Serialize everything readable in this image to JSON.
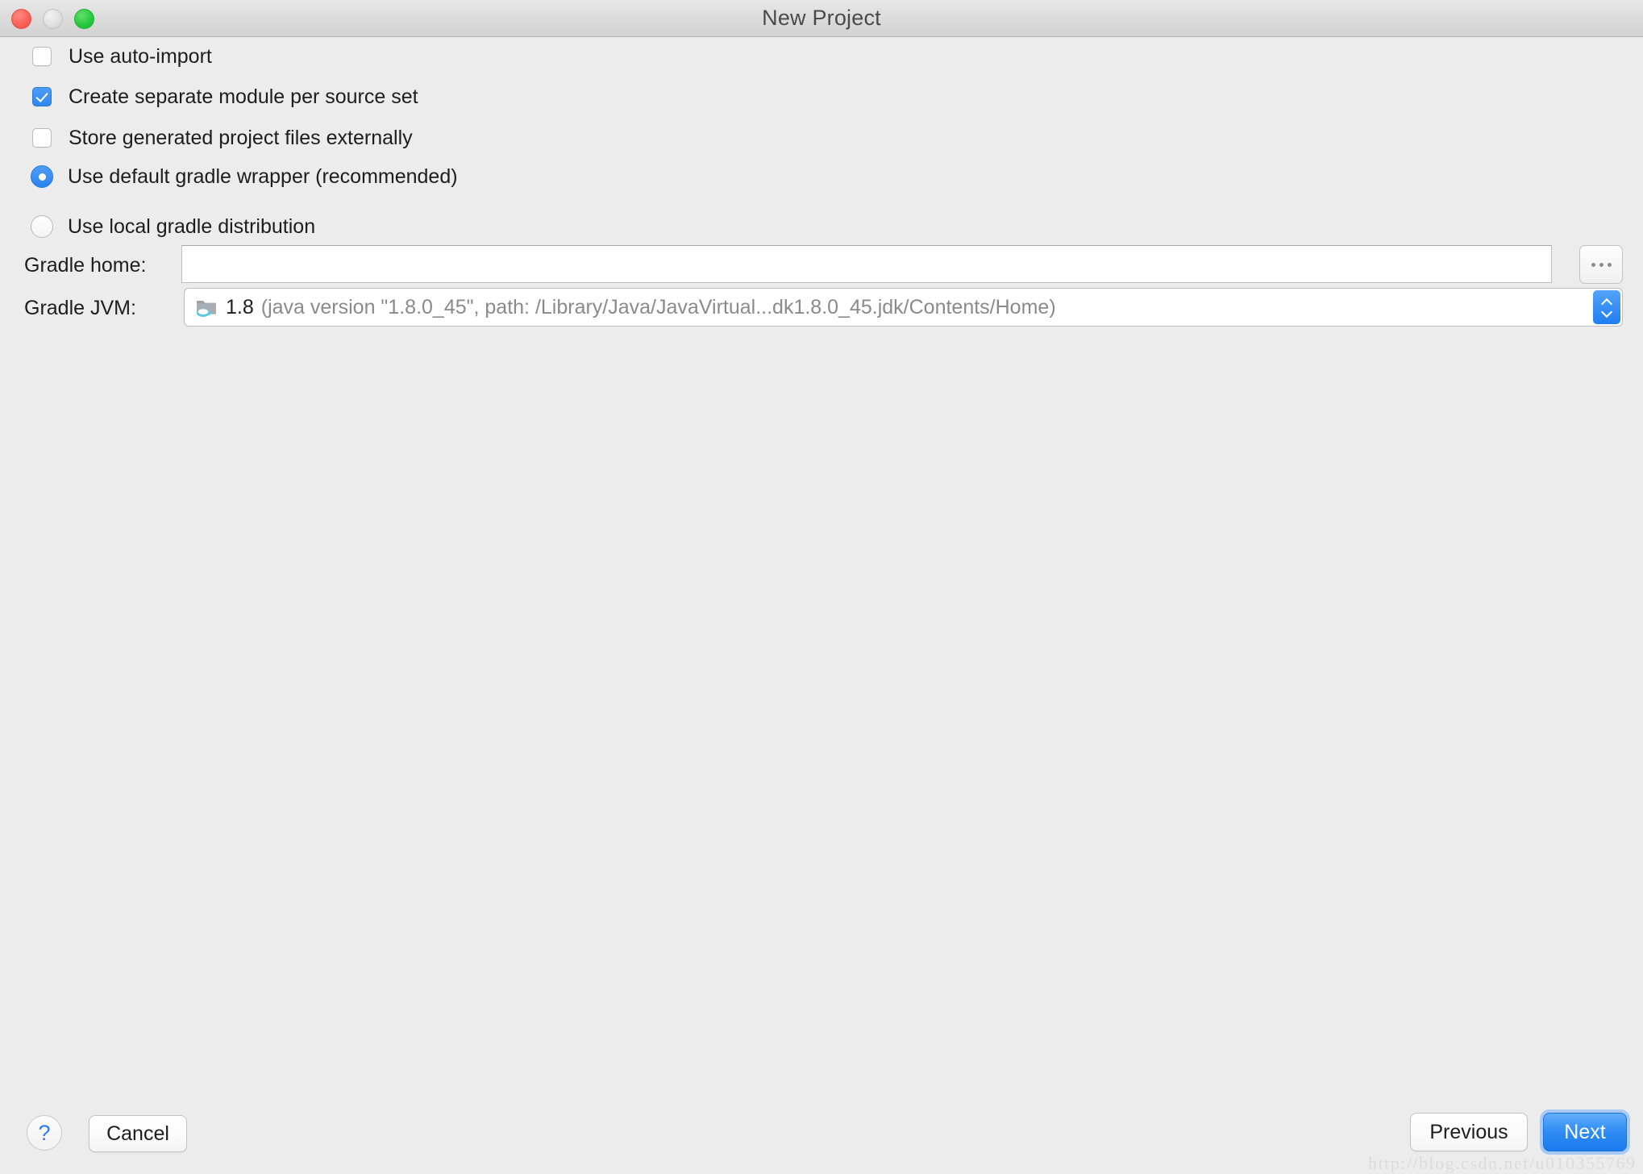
{
  "window": {
    "title": "New Project",
    "traffic_lights": {
      "close": "close-button",
      "minimize": "minimize-button",
      "zoom": "zoom-button"
    },
    "colors": {
      "background": "#ececec",
      "accent_blue": "#2f86f0",
      "primary_button": "#2f8df4",
      "text": "#1d1d1d",
      "muted_text": "#8a8a8a"
    }
  },
  "options": {
    "checkboxes": [
      {
        "label": "Use auto-import",
        "checked": false
      },
      {
        "label": "Create separate module per source set",
        "checked": true
      },
      {
        "label": "Store generated project files externally",
        "checked": false
      }
    ],
    "radios": [
      {
        "label": "Use default gradle wrapper (recommended)",
        "selected": true
      },
      {
        "label": "Use local gradle distribution",
        "selected": false
      }
    ]
  },
  "fields": {
    "gradle_home": {
      "label": "Gradle home:",
      "value": "",
      "placeholder": "",
      "browse_button": "..."
    },
    "gradle_jvm": {
      "label": "Gradle JVM:",
      "version": "1.8",
      "detail": "(java version \"1.8.0_45\", path: /Library/Java/JavaVirtual...dk1.8.0_45.jdk/Contents/Home)",
      "icon": "jdk-folder-icon"
    }
  },
  "footer": {
    "help": "?",
    "cancel": "Cancel",
    "previous": "Previous",
    "next": "Next"
  },
  "watermark": "http://blog.csdn.net/u010355769"
}
